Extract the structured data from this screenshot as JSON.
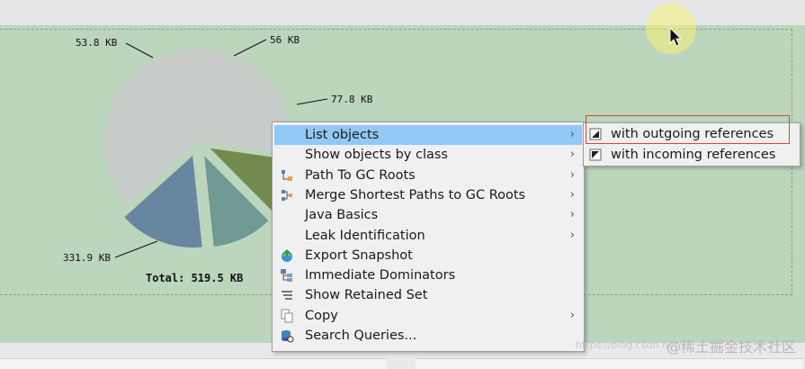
{
  "chart_data": {
    "type": "pie",
    "unit": "KB",
    "slices": [
      {
        "label": "331.9 KB",
        "value": 331.9,
        "color": "#c9cdc9"
      },
      {
        "label": "53.8 KB",
        "value": 53.8,
        "color": "#738a4f"
      },
      {
        "label": "56 KB",
        "value": 56,
        "color": "#6e9a93"
      },
      {
        "label": "77.8 KB",
        "value": 77.8,
        "color": "#6986a0"
      }
    ],
    "total_label": "Total: 519.5 KB"
  },
  "context_menu": {
    "items": [
      {
        "label": "List objects",
        "icon": "none",
        "has_submenu": true,
        "highlighted": true
      },
      {
        "label": "Show objects by class",
        "icon": "none",
        "has_submenu": true
      },
      {
        "label": "Path To GC Roots",
        "icon": "gc-path-icon",
        "has_submenu": true
      },
      {
        "label": "Merge Shortest Paths to GC Roots",
        "icon": "merge-paths-icon",
        "has_submenu": true
      },
      {
        "label": "Java Basics",
        "icon": "none",
        "has_submenu": true
      },
      {
        "label": "Leak Identification",
        "icon": "none",
        "has_submenu": true
      },
      {
        "label": "Export Snapshot",
        "icon": "export-snapshot-icon",
        "has_submenu": false
      },
      {
        "label": "Immediate Dominators",
        "icon": "dominators-icon",
        "has_submenu": false
      },
      {
        "label": "Show Retained Set",
        "icon": "retained-set-icon",
        "has_submenu": false
      },
      {
        "label": "Copy",
        "icon": "copy-icon",
        "has_submenu": true
      },
      {
        "label": "Search Queries...",
        "icon": "search-queries-icon",
        "has_submenu": false
      }
    ]
  },
  "submenu": {
    "items": [
      {
        "label": "with outgoing references",
        "icon": "outgoing-references-icon"
      },
      {
        "label": "with incoming references",
        "icon": "incoming-references-icon"
      }
    ]
  },
  "watermark": {
    "url": "https://blog.csdn.net/",
    "text": "@稀土掘金技术社区"
  },
  "colors": {
    "chart_background": "#bcd5bd",
    "menu_hover": "#91c9f7",
    "highlight_box": "#e0403a"
  }
}
